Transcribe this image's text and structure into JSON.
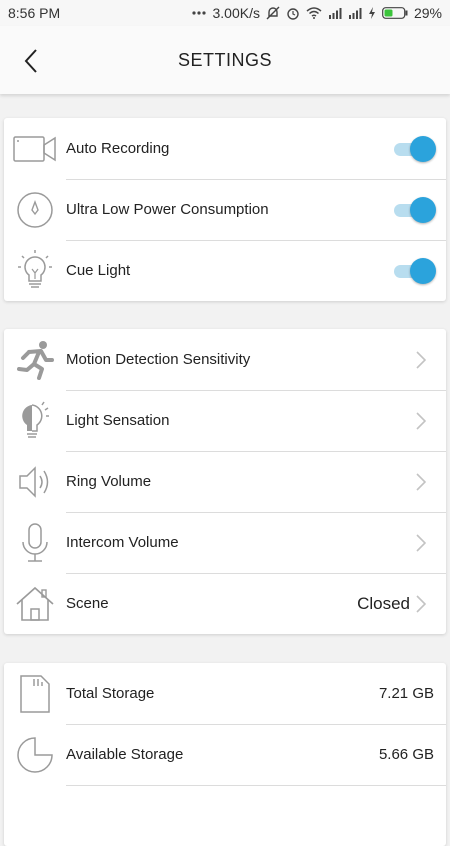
{
  "status_bar": {
    "time": "8:56 PM",
    "network_speed": "3.00K/s",
    "battery": "29%",
    "icons": [
      "dots-icon",
      "mute-icon",
      "alarm-icon",
      "wifi-icon",
      "signal-icon",
      "signal-icon",
      "charging-icon",
      "battery-icon"
    ]
  },
  "header": {
    "title": "SETTINGS",
    "back_icon": "chevron-left-icon"
  },
  "toggle_section": [
    {
      "label": "Auto Recording",
      "icon": "video-camera-icon",
      "enabled": true
    },
    {
      "label": "Ultra Low Power Consumption",
      "icon": "power-compass-icon",
      "enabled": true
    },
    {
      "label": "Cue Light",
      "icon": "light-bulb-icon",
      "enabled": true
    }
  ],
  "nav_section": [
    {
      "label": "Motion Detection Sensitivity",
      "icon": "running-person-icon",
      "value": ""
    },
    {
      "label": "Light Sensation",
      "icon": "half-bulb-icon",
      "value": ""
    },
    {
      "label": "Ring Volume",
      "icon": "speaker-icon",
      "value": ""
    },
    {
      "label": "Intercom Volume",
      "icon": "microphone-icon",
      "value": ""
    },
    {
      "label": "Scene",
      "icon": "house-icon",
      "value": "Closed"
    }
  ],
  "storage_section": [
    {
      "label": "Total Storage",
      "icon": "sd-card-icon",
      "value": "7.21 GB"
    },
    {
      "label": "Available Storage",
      "icon": "pie-chart-icon",
      "value": "5.66 GB"
    }
  ],
  "colors": {
    "accent": "#2ba3dc",
    "toggle_track": "#b8ddef",
    "icon_gray": "#9a9a9a",
    "background": "#f2f2f2"
  }
}
